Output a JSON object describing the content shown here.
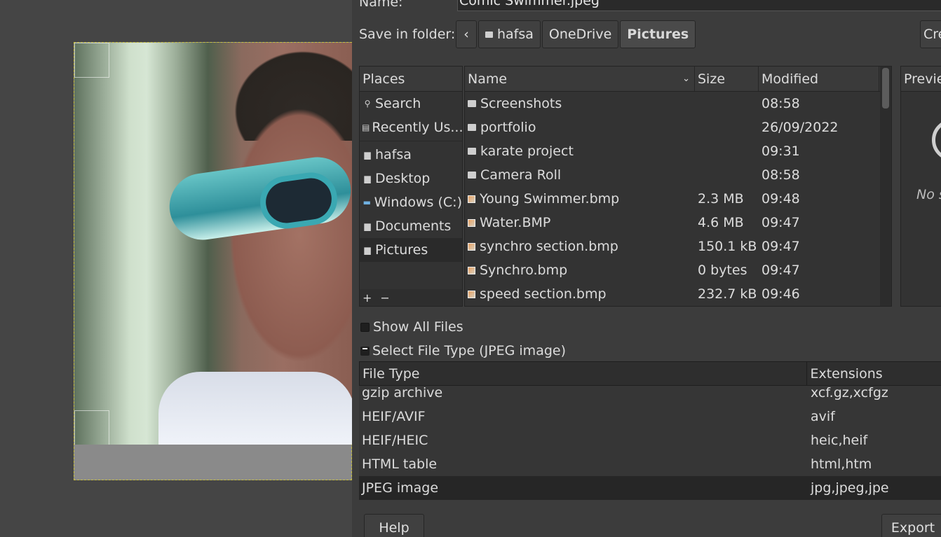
{
  "dialog": {
    "name_label": "Name:",
    "name_value": "Comic Swimmer.jpeg",
    "save_in_label": "Save in folder:",
    "breadcrumb": [
      "hafsa",
      "OneDrive",
      "Pictures"
    ],
    "create_folder_label": "Cre",
    "places": {
      "header": "Places",
      "items": [
        {
          "label": "Search",
          "icon": "search-icon"
        },
        {
          "label": "Recently Us...",
          "icon": "recent-icon"
        },
        {
          "label": "hafsa",
          "icon": "folder-icon"
        },
        {
          "label": "Desktop",
          "icon": "folder-icon"
        },
        {
          "label": "Windows (C:)",
          "icon": "drive-icon"
        },
        {
          "label": "Documents",
          "icon": "folder-icon"
        },
        {
          "label": "Pictures",
          "icon": "folder-icon"
        }
      ],
      "add": "+",
      "remove": "−"
    },
    "files": {
      "columns": {
        "name": "Name",
        "size": "Size",
        "modified": "Modified"
      },
      "rows": [
        {
          "name": "Screenshots",
          "size": "",
          "modified": "08:58",
          "kind": "folder"
        },
        {
          "name": "portfolio",
          "size": "",
          "modified": "26/09/2022",
          "kind": "folder"
        },
        {
          "name": "karate project",
          "size": "",
          "modified": "09:31",
          "kind": "folder"
        },
        {
          "name": "Camera Roll",
          "size": "",
          "modified": "08:58",
          "kind": "folder"
        },
        {
          "name": "Young Swimmer.bmp",
          "size": "2.3 MB",
          "modified": "09:48",
          "kind": "image"
        },
        {
          "name": "Water.BMP",
          "size": "4.6 MB",
          "modified": "09:47",
          "kind": "image"
        },
        {
          "name": "synchro section.bmp",
          "size": "150.1 kB",
          "modified": "09:47",
          "kind": "image"
        },
        {
          "name": "Synchro.bmp",
          "size": "0 bytes",
          "modified": "09:47",
          "kind": "image"
        },
        {
          "name": "speed section.bmp",
          "size": "232.7 kB",
          "modified": "09:46",
          "kind": "image"
        }
      ]
    },
    "preview": {
      "header": "Previe",
      "text": "No s"
    },
    "show_all_files": "Show All Files",
    "select_file_type": "Select File Type (JPEG image)",
    "file_types": {
      "columns": {
        "type": "File Type",
        "ext": "Extensions"
      },
      "rows": [
        {
          "type": "gzip archive",
          "ext": "xcf.gz,xcfgz"
        },
        {
          "type": "HEIF/AVIF",
          "ext": "avif"
        },
        {
          "type": "HEIF/HEIC",
          "ext": "heic,heif"
        },
        {
          "type": "HTML table",
          "ext": "html,htm"
        },
        {
          "type": "JPEG image",
          "ext": "jpg,jpeg,jpe",
          "selected": true
        }
      ]
    },
    "help_label": "Help",
    "export_label": "Export"
  }
}
